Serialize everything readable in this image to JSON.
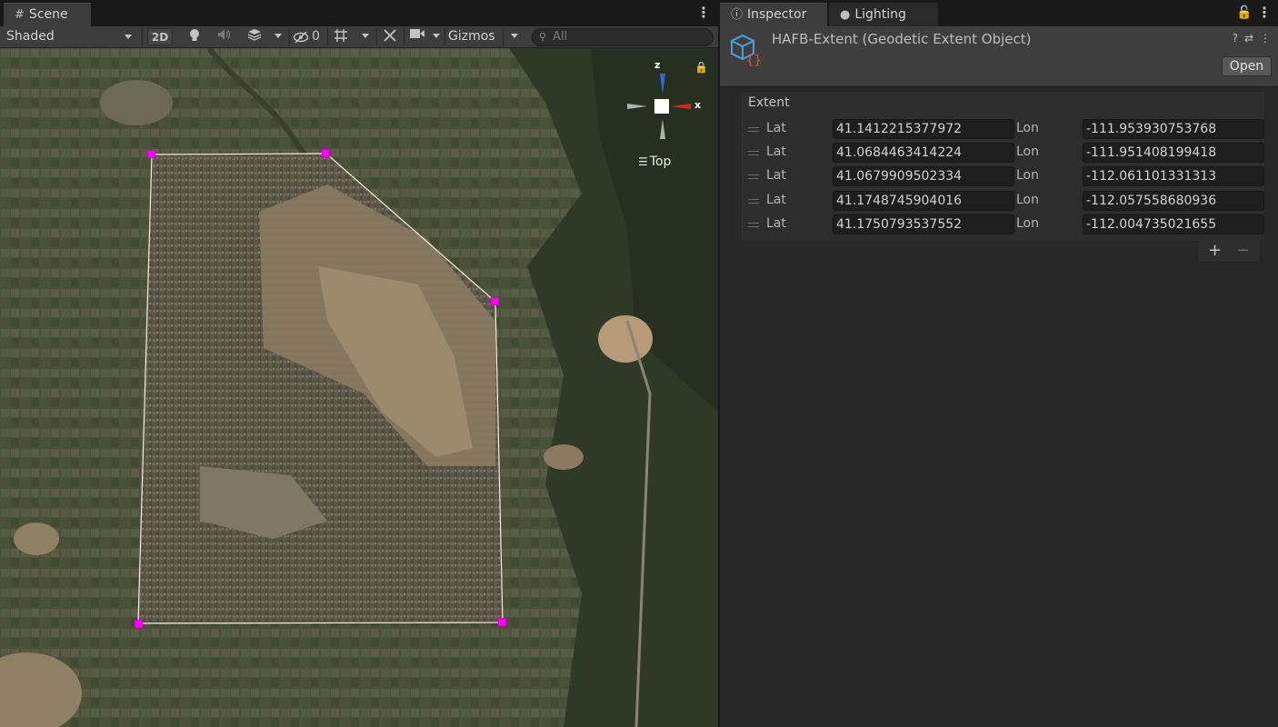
{
  "scene": {
    "tab_label": "Scene",
    "tab_icon": "#",
    "shading_mode": "Shaded",
    "btn_2d": "2D",
    "hidden_count": "0",
    "gizmos_label": "Gizmos",
    "search_placeholder": "All",
    "orientation_label": "Top",
    "gizmo_z": "z",
    "gizmo_x": "x"
  },
  "tabs": {
    "inspector_label": "Inspector",
    "lighting_label": "Lighting"
  },
  "inspector": {
    "asset_title": "HAFB-Extent (Geodetic Extent Object)",
    "open_button": "Open",
    "extent_label": "Extent",
    "lat_label": "Lat",
    "lon_label": "Lon",
    "rows": [
      {
        "lat": "41.1412215377972",
        "lon": "-111.953930753768"
      },
      {
        "lat": "41.0684463414224",
        "lon": "-111.951408199418"
      },
      {
        "lat": "41.0679909502334",
        "lon": "-112.061101331313"
      },
      {
        "lat": "41.1748745904016",
        "lon": "-112.057558680936"
      },
      {
        "lat": "41.1750793537552",
        "lon": "-112.004735021655"
      }
    ],
    "add_button": "+",
    "remove_button": "−"
  },
  "colors": {
    "handle": "#ff00ff",
    "editor_bg": "#282828",
    "accent_blue": "#2f6bd8",
    "accent_red": "#d6261b"
  }
}
